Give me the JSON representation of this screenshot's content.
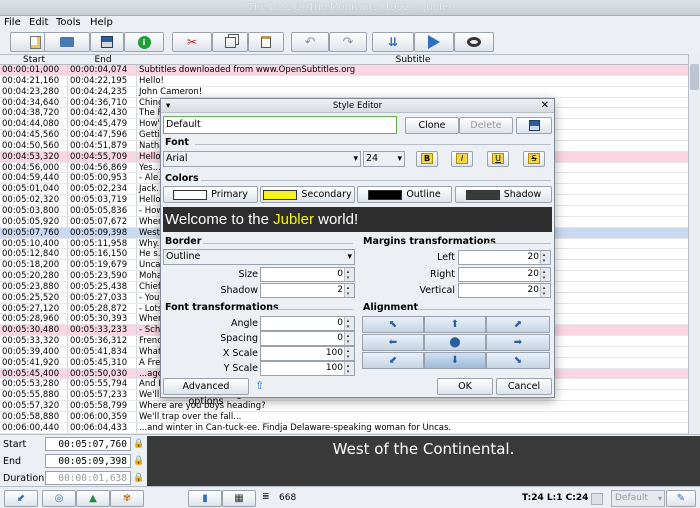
{
  "window": {
    "title": "The Last Of The Mohicans (1992) - Jubler"
  },
  "menu": [
    "File",
    "Edit",
    "Tools",
    "Help"
  ],
  "table": {
    "headers": {
      "start": "Start",
      "end": "End",
      "subtitle": "Subtitle"
    },
    "rows": [
      {
        "start": "00:00:01,000",
        "end": "00:00:04,074",
        "text": "Subtitles downloaded from www.OpenSubtitles.org",
        "hl": "pink"
      },
      {
        "start": "00:04:21,160",
        "end": "00:04:22,195",
        "text": "Hello!",
        "hl": ""
      },
      {
        "start": "00:04:23,280",
        "end": "00:04:24,235",
        "text": "John Cameron!",
        "hl": ""
      },
      {
        "start": "00:04:34,640",
        "end": "00:04:36,710",
        "text": "Chingachgook...",
        "hl": ""
      },
      {
        "start": "00:04:38,720",
        "end": "00:04:42,430",
        "text": "The Frontier...",
        "hl": ""
      },
      {
        "start": "00:04:44,080",
        "end": "00:04:45,479",
        "text": "How's your...",
        "hl": ""
      },
      {
        "start": "00:04:45,560",
        "end": "00:04:47,596",
        "text": "Getting...",
        "hl": ""
      },
      {
        "start": "00:04:50,560",
        "end": "00:04:51,879",
        "text": "Nathaniel...",
        "hl": ""
      },
      {
        "start": "00:04:53,320",
        "end": "00:04:55,709",
        "text": "Hello...",
        "hl": "pink"
      },
      {
        "start": "00:04:56,000",
        "end": "00:04:56,869",
        "text": "Yes...",
        "hl": ""
      },
      {
        "start": "00:04:59,440",
        "end": "00:05:00,953",
        "text": "- Ale...",
        "hl": ""
      },
      {
        "start": "00:05:01,040",
        "end": "00:05:02,234",
        "text": "Jack...",
        "hl": ""
      },
      {
        "start": "00:05:02,320",
        "end": "00:05:03,719",
        "text": "Hello...",
        "hl": ""
      },
      {
        "start": "00:05:03,800",
        "end": "00:05:05,836",
        "text": "- How...",
        "hl": ""
      },
      {
        "start": "00:05:05,920",
        "end": "00:05:07,672",
        "text": "Where...",
        "hl": ""
      },
      {
        "start": "00:05:07,760",
        "end": "00:05:09,398",
        "text": "West...",
        "hl": "sel"
      },
      {
        "start": "00:05:10,400",
        "end": "00:05:11,958",
        "text": "Why...",
        "hl": ""
      },
      {
        "start": "00:05:12,840",
        "end": "00:05:16,150",
        "text": "He s...",
        "hl": ""
      },
      {
        "start": "00:05:18,200",
        "end": "00:05:19,679",
        "text": "Uncas...",
        "hl": ""
      },
      {
        "start": "00:05:20,280",
        "end": "00:05:23,590",
        "text": "Moha...",
        "hl": ""
      },
      {
        "start": "00:05:23,880",
        "end": "00:05:25,438",
        "text": "Chief...",
        "hl": ""
      },
      {
        "start": "00:05:25,520",
        "end": "00:05:27,033",
        "text": "- You...",
        "hl": ""
      },
      {
        "start": "00:05:27,120",
        "end": "00:05:28,872",
        "text": "- Lots...",
        "hl": ""
      },
      {
        "start": "00:05:28,960",
        "end": "00:05:30,393",
        "text": "Wher...",
        "hl": ""
      },
      {
        "start": "00:05:30,480",
        "end": "00:05:33,233",
        "text": "- Sch...",
        "hl": "pink"
      },
      {
        "start": "00:05:33,320",
        "end": "00:05:36,312",
        "text": "Frenc...",
        "hl": ""
      },
      {
        "start": "00:05:39,400",
        "end": "00:05:41,834",
        "text": "What...",
        "hl": ""
      },
      {
        "start": "00:05:41,920",
        "end": "00:05:45,310",
        "text": "A Fre...",
        "hl": ""
      },
      {
        "start": "00:05:45,400",
        "end": "00:05:50,030",
        "text": "...ago...",
        "hl": "pink"
      },
      {
        "start": "00:05:53,280",
        "end": "00:05:55,794",
        "text": "And I...",
        "hl": ""
      },
      {
        "start": "00:05:55,880",
        "end": "00:05:57,233",
        "text": "We'll see in the morning.",
        "hl": ""
      },
      {
        "start": "00:05:57,320",
        "end": "00:05:58,799",
        "text": "Where are you boys heading?",
        "hl": ""
      },
      {
        "start": "00:05:58,880",
        "end": "00:06:00,359",
        "text": "We'll trap over the fall...",
        "hl": ""
      },
      {
        "start": "00:06:00,440",
        "end": "00:06:04,433",
        "text": "...and winter in Can-tuck-ee. Findja Delaware-speaking woman for Uncas.",
        "hl": ""
      }
    ]
  },
  "timing": {
    "start_label": "Start",
    "start_value": "00:05:07,760",
    "end_label": "End",
    "end_value": "00:05:09,398",
    "duration_label": "Duration",
    "duration_value": "00:00:01,638"
  },
  "preview_text": "West of the Continental.",
  "status": {
    "count": "668",
    "position": "T:24 L:1 C:24",
    "style": "Default"
  },
  "style_editor": {
    "title": "Style Editor",
    "style_name": "Default",
    "clone_label": "Clone",
    "delete_label": "Delete",
    "font_section": "Font",
    "font_name": "Arial",
    "font_size": "24",
    "bold": "B",
    "italic": "I",
    "underline": "U",
    "strike": "S",
    "colors_section": "Colors",
    "colors": {
      "primary": {
        "label": "Primary",
        "color": "#ffffff"
      },
      "secondary": {
        "label": "Secondary",
        "color": "#f5f51a"
      },
      "outline": {
        "label": "Outline",
        "color": "#000000"
      },
      "shadow": {
        "label": "Shadow",
        "color": "#3a3a3a"
      }
    },
    "preview": {
      "before": "Welcome to the ",
      "highlight": "Jubler",
      "after": " world!"
    },
    "border": {
      "section": "Border",
      "type": "Outline",
      "size_label": "Size",
      "size": "0",
      "shadow_label": "Shadow",
      "shadow": "2"
    },
    "margins": {
      "section": "Margins transformations",
      "left_label": "Left",
      "left": "20",
      "right_label": "Right",
      "right": "20",
      "vertical_label": "Vertical",
      "vertical": "20"
    },
    "font_transform": {
      "section": "Font transformations",
      "angle_label": "Angle",
      "angle": "0",
      "spacing_label": "Spacing",
      "spacing": "0",
      "xscale_label": "X Scale",
      "xscale": "100",
      "yscale_label": "Y Scale",
      "yscale": "100"
    },
    "alignment": {
      "section": "Alignment"
    },
    "advanced_label": "Advanced options",
    "ok_label": "OK",
    "cancel_label": "Cancel"
  }
}
